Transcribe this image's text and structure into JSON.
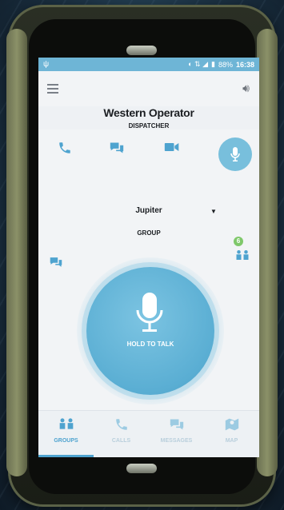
{
  "status_bar": {
    "usb_icon": "usb-icon",
    "battery": "88%",
    "time": "16:38"
  },
  "app_bar": {
    "menu_icon": "hamburger-menu-icon",
    "volume_icon": "volume-icon"
  },
  "contact": {
    "name": "Western Operator",
    "role": "DISPATCHER"
  },
  "actions": [
    {
      "name": "call",
      "icon": "phone-icon"
    },
    {
      "name": "message",
      "icon": "chat-icon"
    },
    {
      "name": "video",
      "icon": "video-camera-icon"
    },
    {
      "name": "ptt",
      "icon": "microphone-icon"
    }
  ],
  "group": {
    "name": "Jupiter",
    "type": "GROUP",
    "unread_count": "6"
  },
  "ptt": {
    "label": "HOLD TO TALK"
  },
  "bottom_nav": [
    {
      "label": "GROUPS",
      "icon": "groups-icon",
      "active": true
    },
    {
      "label": "CALLS",
      "icon": "phone-icon",
      "active": false
    },
    {
      "label": "MESSAGES",
      "icon": "chat-icon",
      "active": false
    },
    {
      "label": "MAP",
      "icon": "map-icon",
      "active": false
    }
  ],
  "colors": {
    "accent": "#4ea3cf",
    "status_bar": "#6eb5d6",
    "ptt": "#5aaed3",
    "badge": "#7fc86a"
  }
}
